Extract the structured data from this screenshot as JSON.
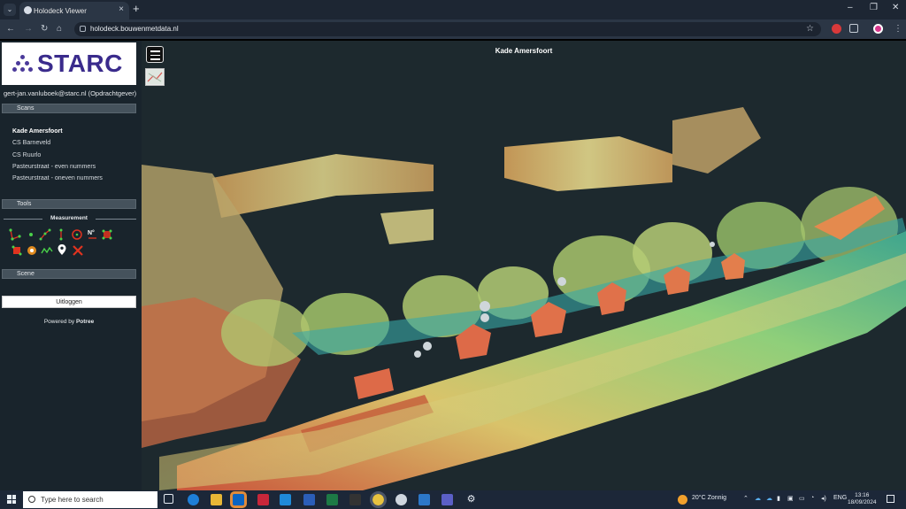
{
  "browser": {
    "tab_title": "Holodeck Viewer",
    "url": "holodeck.bouwenmetdata.nl",
    "new_tab_icon": "plus-icon",
    "window_controls": [
      "minimize-icon",
      "restore-icon",
      "close-icon"
    ]
  },
  "sidebar": {
    "logo_text": "STARC",
    "user": "gert-jan.vanluboek@starc.nl (Opdrachtgever)",
    "scans_label": "Scans",
    "scans": [
      "Kade Amersfoort",
      "CS Barneveld",
      "CS Ruurlo",
      "Pasteurstraat - even nummers",
      "Pasteurstraat - oneven nummers"
    ],
    "active_scan": "Kade Amersfoort",
    "tools_label": "Tools",
    "measurement_label": "Measurement",
    "scene_label": "Scene",
    "logout_label": "Uitloggen",
    "powered_prefix": "Powered by ",
    "powered_brand": "Potree"
  },
  "viewer": {
    "title": "Kade Amersfoort"
  },
  "taskbar": {
    "search_placeholder": "Type here to search",
    "weather": "20°C  Zonnig",
    "lang": "ENG",
    "time": "13:16",
    "date": "18/09/2024"
  },
  "colors": {
    "sidebar_bg": "#19242c",
    "accent": "#3a2b8c",
    "tool_green": "#4ad14a",
    "tool_red": "#e0331f"
  }
}
